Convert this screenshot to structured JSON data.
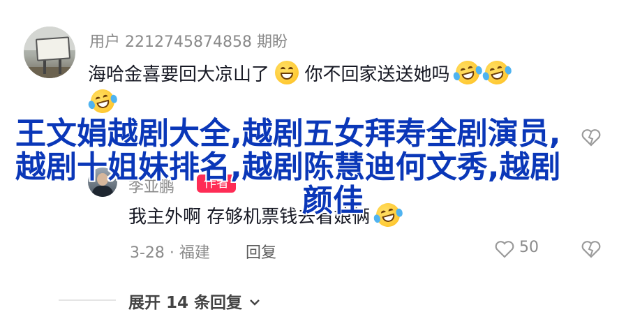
{
  "comment": {
    "username": "用户 2212745874858 期盼",
    "text_part1": "海哈金喜要回大凉山了",
    "text_part2": "你不回家送送她吗",
    "emojis": [
      "grin-emoji",
      "laugh-tears-emoji",
      "laugh-tears-emoji",
      "laugh-tears-emoji"
    ]
  },
  "overlay": {
    "line1": "王文娟越剧大全,越剧五女拜寿全剧演员,",
    "line2": "越剧十姐妹排名,越剧陈慧迪何文秀,越剧",
    "line3": "颜佳"
  },
  "reply": {
    "username": "李亚鹏",
    "badge": "作者",
    "text": "我主外啊 存够机票钱去看娘俩",
    "date_location": "3-28 · 福建",
    "reply_label": "回复",
    "like_count": "50"
  },
  "footer": {
    "expand_label": "展开 14 条回复"
  },
  "colors": {
    "overlay_text": "#0a37b8",
    "badge_bg": "#fe2c55",
    "meta_text": "#8a8a8a"
  }
}
